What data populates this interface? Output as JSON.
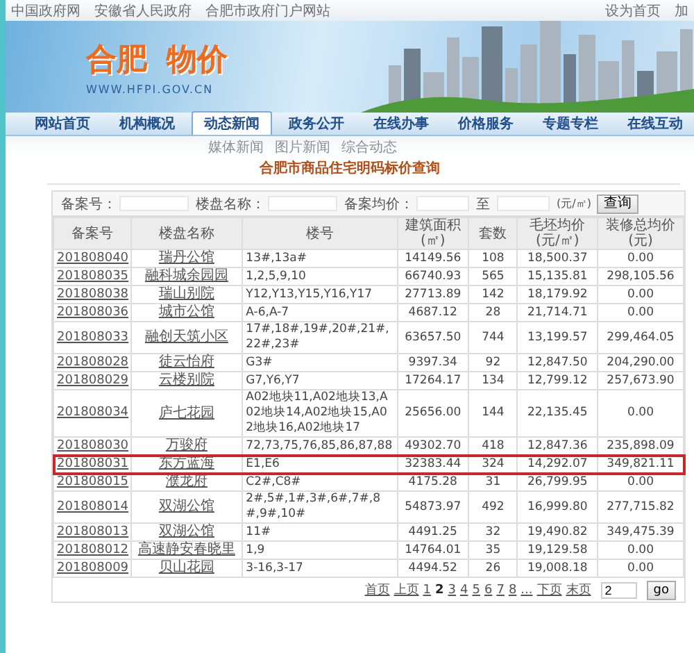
{
  "top_bar": {
    "links": [
      "中国政府网",
      "安徽省人民政府",
      "合肥市政府门户网站"
    ],
    "right_links": [
      "设为首页",
      "加"
    ]
  },
  "banner": {
    "logo_words": [
      "合肥",
      "物价"
    ],
    "url": "WWW.HFPI.GOV.CN"
  },
  "nav": {
    "tabs": [
      {
        "label": "网站首页",
        "selected": false
      },
      {
        "label": "机构概况",
        "selected": false
      },
      {
        "label": "动态新闻",
        "selected": true
      },
      {
        "label": "政务公开",
        "selected": false
      },
      {
        "label": "在线办事",
        "selected": false
      },
      {
        "label": "价格服务",
        "selected": false
      },
      {
        "label": "专题专栏",
        "selected": false
      },
      {
        "label": "在线互动",
        "selected": false
      }
    ],
    "sub_links": [
      "媒体新闻",
      "图片新闻",
      "综合动态"
    ]
  },
  "query": {
    "title": "合肥市商品住宅明码标价查询",
    "form": {
      "labels": [
        "备案号：",
        "楼盘名称：",
        "备案均价："
      ],
      "range_word": "至",
      "unit": "(元/㎡)",
      "button": "查询"
    },
    "table": {
      "columns": [
        {
          "label": "备案号",
          "kind": "link"
        },
        {
          "label": "楼盘名称",
          "kind": "link"
        },
        {
          "label": "楼号",
          "kind": "text"
        },
        {
          "label": "建筑面积(㎡)",
          "kind": "number"
        },
        {
          "label": "套数",
          "kind": "number"
        },
        {
          "label": "毛坯均价(元/㎡)",
          "kind": "number"
        },
        {
          "label": "装修总均价(元)",
          "kind": "number"
        }
      ],
      "rows": [
        {
          "cells": [
            "201808040",
            "瑞丹公馆",
            "13#,13a#",
            "14149.56",
            "108",
            "18,500.37",
            "0.00"
          ],
          "highlighted": false
        },
        {
          "cells": [
            "201808035",
            "融科城余园园",
            "1,2,5,9,10",
            "66740.93",
            "565",
            "15,135.81",
            "298,105.56"
          ],
          "highlighted": false
        },
        {
          "cells": [
            "201808038",
            "瑞山别院",
            "Y12,Y13,Y15,Y16,Y17",
            "27713.89",
            "142",
            "18,179.92",
            "0.00"
          ],
          "highlighted": false
        },
        {
          "cells": [
            "201808036",
            "城市公馆",
            "A-6,A-7",
            "4687.12",
            "28",
            "21,714.71",
            "0.00"
          ],
          "highlighted": false
        },
        {
          "cells": [
            "201808033",
            "融创天筑小区",
            "17#,18#,19#,20#,21#,22#,23#",
            "63657.50",
            "744",
            "13,199.57",
            "299,464.05"
          ],
          "highlighted": false
        },
        {
          "cells": [
            "201808028",
            "徒云怡府",
            "G3#",
            "9397.34",
            "92",
            "12,847.50",
            "204,290.00"
          ],
          "highlighted": false
        },
        {
          "cells": [
            "201808029",
            "云楼别院",
            "G7,Y6,Y7",
            "17264.17",
            "134",
            "12,799.12",
            "257,673.90"
          ],
          "highlighted": false
        },
        {
          "cells": [
            "201808034",
            "庐七花园",
            "A02地块11,A02地块13,A02地块14,A02地块15,A02地块16,A02地块17",
            "25656.00",
            "144",
            "22,135.45",
            "0.00"
          ],
          "highlighted": false
        },
        {
          "cells": [
            "201808030",
            "万骏府",
            "72,73,75,76,85,86,87,88",
            "49302.70",
            "418",
            "12,847.36",
            "235,898.09"
          ],
          "highlighted": false
        },
        {
          "cells": [
            "201808031",
            "东方蓝海",
            "E1,E6",
            "32383.44",
            "324",
            "14,292.07",
            "349,821.11"
          ],
          "highlighted": true
        },
        {
          "cells": [
            "201808015",
            "濮龙府",
            "C2#,C8#",
            "4175.28",
            "31",
            "26,799.95",
            "0.00"
          ],
          "highlighted": false
        },
        {
          "cells": [
            "201808014",
            "双湖公馆",
            "2#,5#,1#,3#,6#,7#,8#,9#,10#",
            "54873.97",
            "492",
            "16,999.80",
            "277,715.82"
          ],
          "highlighted": false
        },
        {
          "cells": [
            "201808013",
            "双湖公馆",
            "11#",
            "4491.25",
            "32",
            "19,490.82",
            "349,475.39"
          ],
          "highlighted": false
        },
        {
          "cells": [
            "201808012",
            "高速静安春晓里",
            "1,9",
            "14764.01",
            "35",
            "19,129.58",
            "0.00"
          ],
          "highlighted": false
        },
        {
          "cells": [
            "201808009",
            "贝山花园",
            "3-16,3-17",
            "4494.52",
            "26",
            "19,008.18",
            "0.00"
          ],
          "highlighted": false
        }
      ]
    },
    "pager": {
      "items": [
        {
          "label": "首页",
          "selected": false
        },
        {
          "label": "上页",
          "selected": false
        },
        {
          "label": "1",
          "selected": false
        },
        {
          "label": "2",
          "selected": true
        },
        {
          "label": "3",
          "selected": false
        },
        {
          "label": "4",
          "selected": false
        },
        {
          "label": "5",
          "selected": false
        },
        {
          "label": "6",
          "selected": false
        },
        {
          "label": "7",
          "selected": false
        },
        {
          "label": "8",
          "selected": false
        },
        {
          "label": "...",
          "selected": false
        },
        {
          "label": "下页",
          "selected": false
        },
        {
          "label": "末页",
          "selected": false
        }
      ],
      "page_value": "2",
      "button": "go"
    }
  }
}
